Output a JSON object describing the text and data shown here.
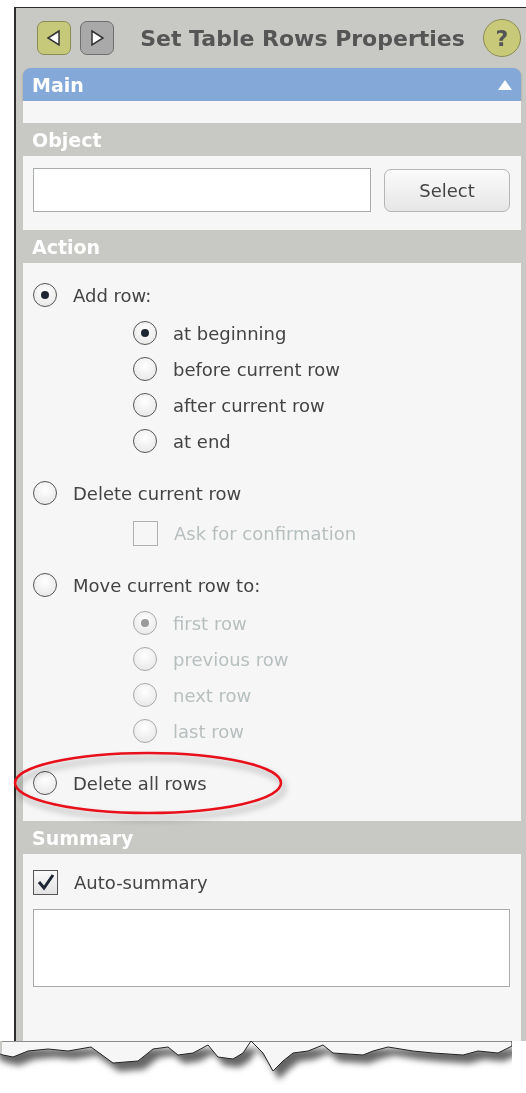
{
  "window": {
    "title": "Set Table Rows Properties"
  },
  "nav_buttons": [
    {
      "kind": "back",
      "active": true
    },
    {
      "kind": "forward",
      "active": false
    }
  ],
  "help_button": {
    "label": "?"
  },
  "main_panel": {
    "title": "Main",
    "expanded": true
  },
  "object_section": {
    "title": "Object",
    "button": "Select"
  },
  "action_section": {
    "title": "Action",
    "options": [
      {
        "label": "Add row:",
        "selected": true,
        "disabled": false,
        "highlighted": false,
        "children": [
          {
            "label": "at beginning",
            "selected": true,
            "disabled": false
          },
          {
            "label": "before current row",
            "selected": false,
            "disabled": false
          },
          {
            "label": "after current row",
            "selected": false,
            "disabled": false
          },
          {
            "label": "at end",
            "selected": false,
            "disabled": false
          }
        ]
      },
      {
        "label": "Delete current row",
        "selected": false,
        "disabled": false,
        "highlighted": false,
        "checkbox": {
          "label": "Ask for confirmation",
          "checked": false,
          "disabled": true
        }
      },
      {
        "label": "Move current row to:",
        "selected": false,
        "disabled": false,
        "highlighted": false,
        "children": [
          {
            "label": "first row",
            "selected": true,
            "disabled": true
          },
          {
            "label": "previous row",
            "selected": false,
            "disabled": true
          },
          {
            "label": "next row",
            "selected": false,
            "disabled": true
          },
          {
            "label": "last row",
            "selected": false,
            "disabled": true
          }
        ]
      },
      {
        "label": "Delete all rows",
        "selected": false,
        "disabled": false,
        "highlighted": true
      }
    ]
  },
  "summary_section": {
    "title": "Summary",
    "checkbox": {
      "label": "Auto-summary",
      "checked": true,
      "disabled": false
    }
  }
}
